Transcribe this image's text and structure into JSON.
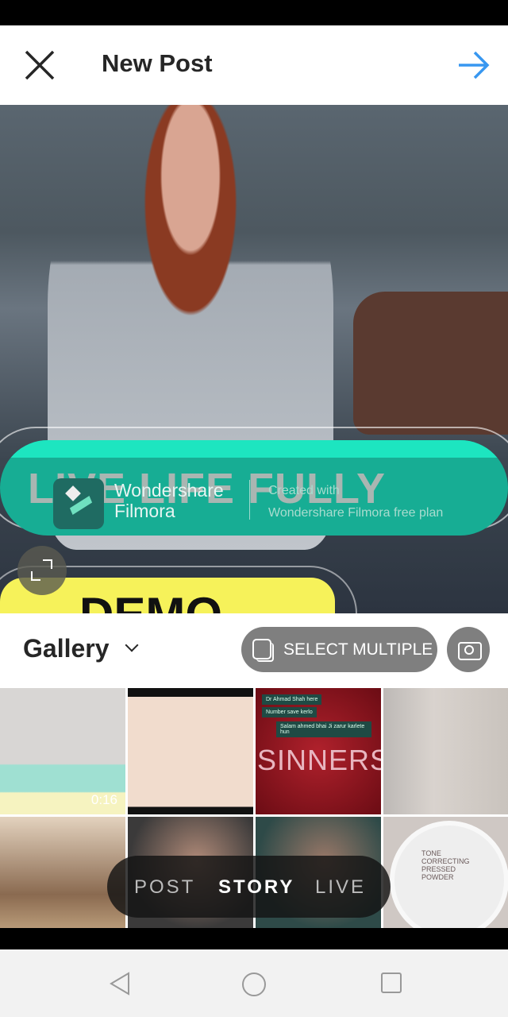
{
  "header": {
    "title": "New Post",
    "close_icon": "close-icon",
    "next_icon": "arrow-right-icon",
    "accent": "#3897f0"
  },
  "preview": {
    "headline": "LIVE LIFE FULLY",
    "watermark_brand_line1": "Wondershare",
    "watermark_brand_line2": "Filmora",
    "watermark_created": "Created with",
    "watermark_plan": "Wondershare Filmora free plan",
    "demo_text": "DEMO"
  },
  "gallery_bar": {
    "source": "Gallery",
    "select_multiple": "SELECT MULTIPLE"
  },
  "grid": {
    "video_duration": "0:16",
    "thumb_text_sinners": "SINNERS",
    "chat_lines": [
      "Dr Ahmad Shah here",
      "Number save kerlo",
      "Salam ahmed bhai Ji zarur karlete hun"
    ],
    "powder_label": "TONE CORRECTING PRESSED POWDER"
  },
  "modes": [
    {
      "label": "POST",
      "active": false
    },
    {
      "label": "STORY",
      "active": true
    },
    {
      "label": "LIVE",
      "active": false
    }
  ]
}
